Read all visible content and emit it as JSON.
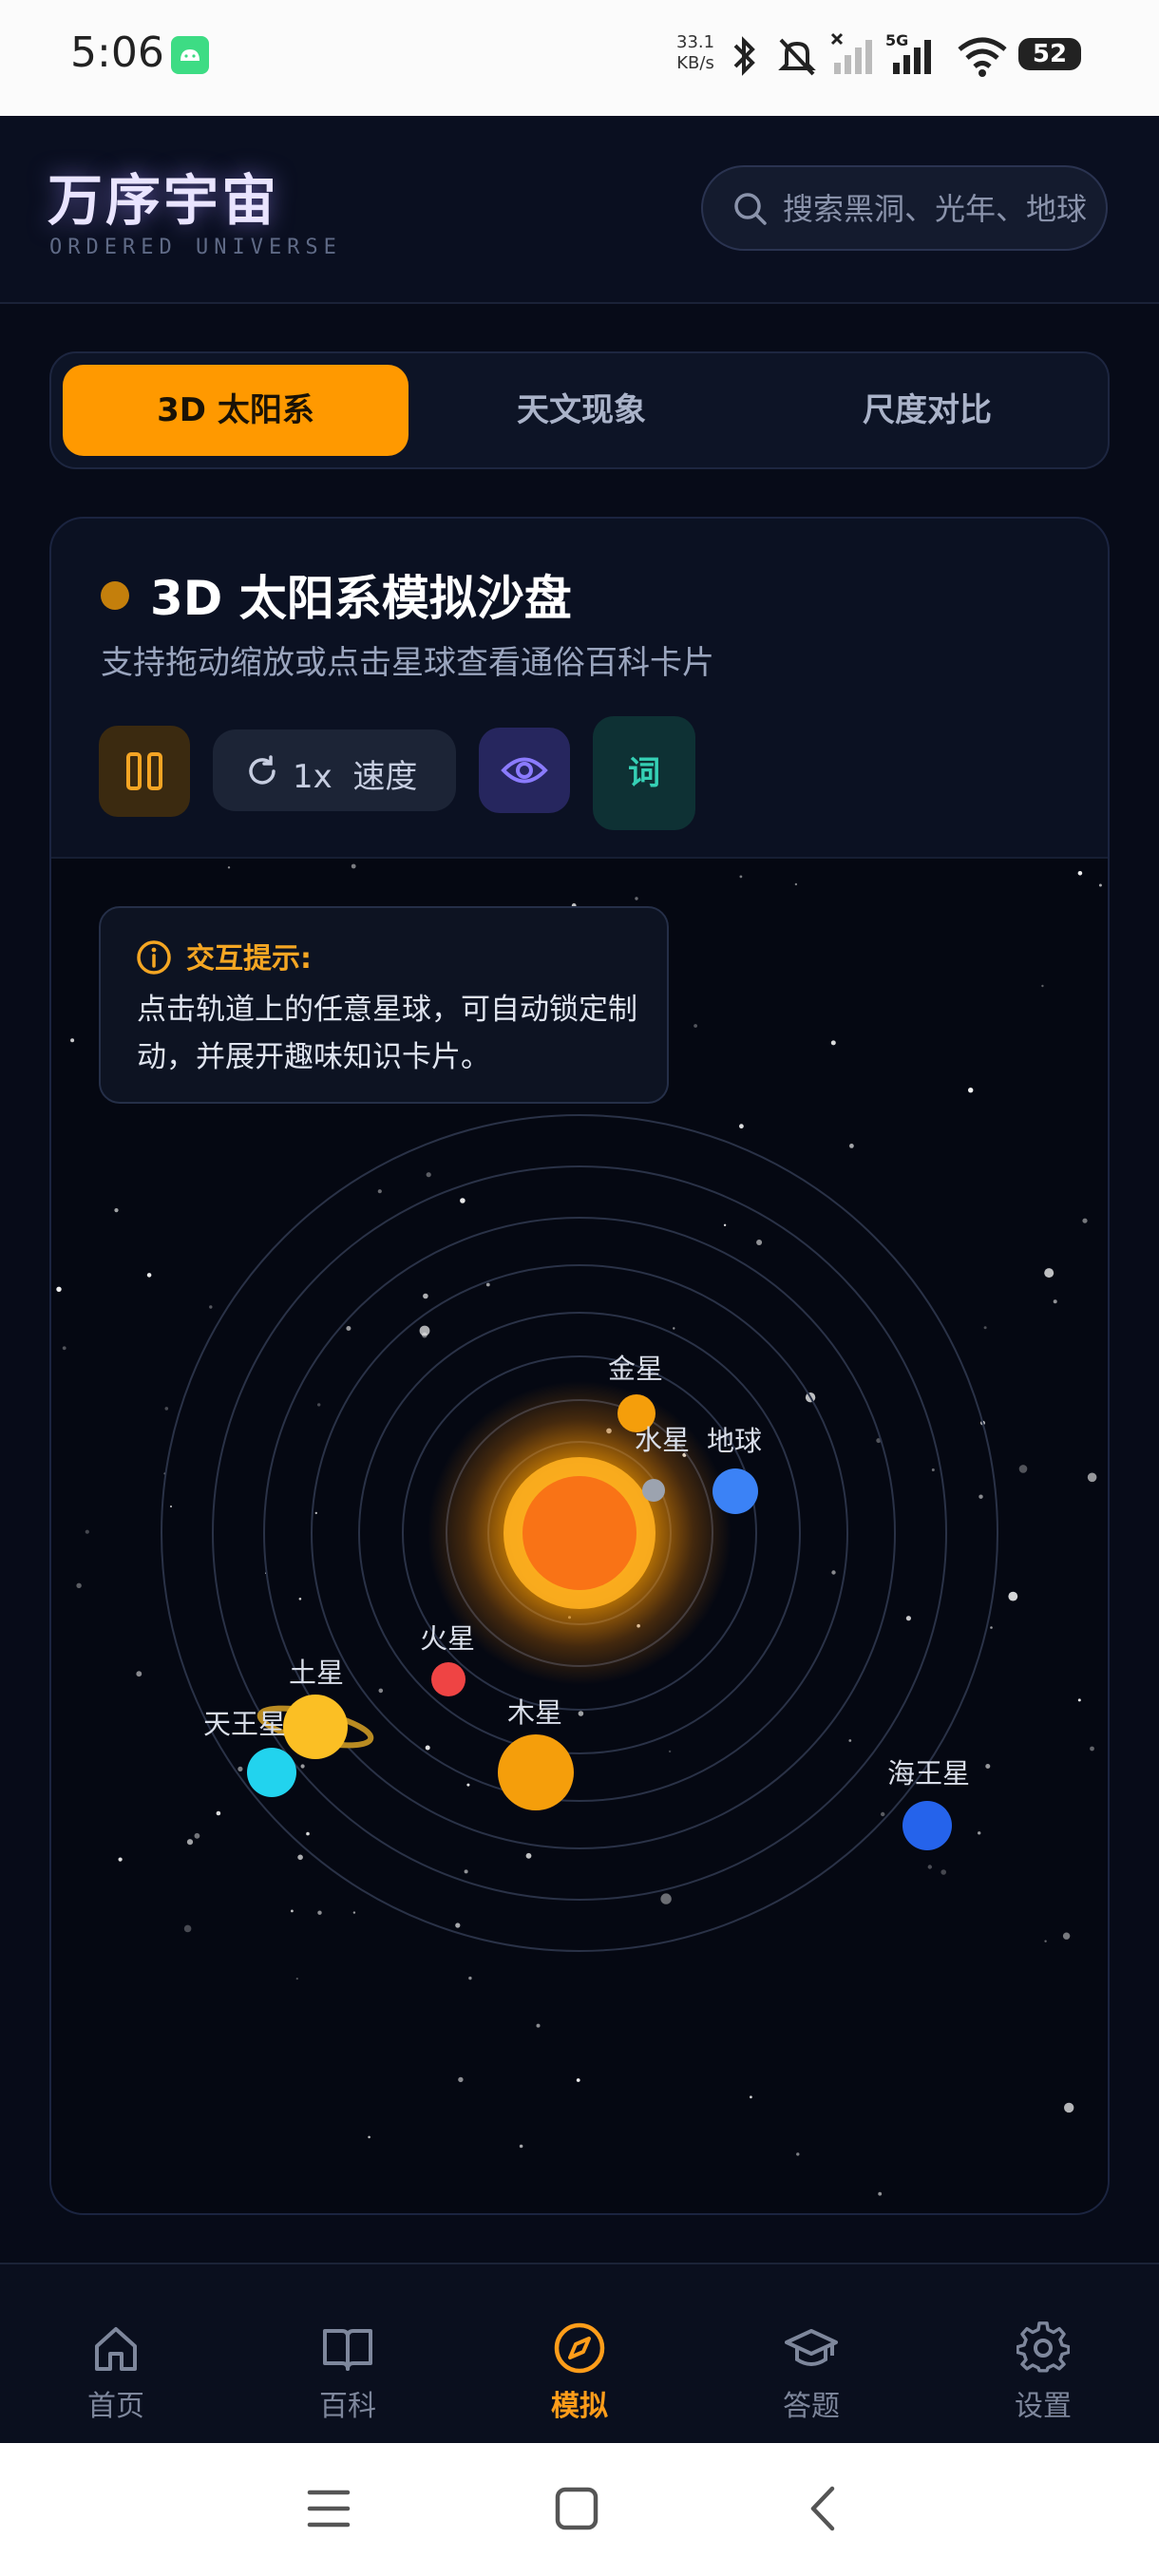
{
  "status_bar": {
    "time": "5:06",
    "net_speed_value": "33.1",
    "net_speed_unit": "KB/s",
    "network": "5G",
    "battery": "52",
    "icons": [
      "android-icon",
      "bluetooth-icon",
      "mute-icon",
      "no-signal-icon",
      "signal-icon",
      "wifi-icon",
      "battery-icon"
    ]
  },
  "header": {
    "title": "万序宇宙",
    "subtitle": "ORDERED UNIVERSE",
    "search_placeholder": "搜索黑洞、光年、地球"
  },
  "tabs": [
    {
      "label": "3D 太阳系",
      "active": true
    },
    {
      "label": "天文现象",
      "active": false
    },
    {
      "label": "尺度对比",
      "active": false
    }
  ],
  "card": {
    "title": "3D 太阳系模拟沙盘",
    "description": "支持拖动缩放或点击星球查看通俗百科卡片",
    "controls": {
      "speed_value": "1x",
      "speed_label": "速度",
      "glossary_label": "词"
    },
    "tip": {
      "title": "交互提示:",
      "body": "点击轨道上的任意星球，可自动锁定制动，并展开趣味知识卡片。"
    }
  },
  "planets": [
    {
      "name": "水星",
      "color": "#9ca3af"
    },
    {
      "name": "金星",
      "color": "#f59e0b"
    },
    {
      "name": "地球",
      "color": "#3b82f6"
    },
    {
      "name": "火星",
      "color": "#ef4444"
    },
    {
      "name": "木星",
      "color": "#f59e0b"
    },
    {
      "name": "土星",
      "color": "#fbbf24"
    },
    {
      "name": "天王星",
      "color": "#22d3ee"
    },
    {
      "name": "海王星",
      "color": "#2563eb"
    }
  ],
  "colors": {
    "accent": "#ff9900",
    "background": "#070b18",
    "sun": "#f97316"
  },
  "bottom_nav": [
    {
      "label": "首页",
      "icon": "home-icon",
      "active": false
    },
    {
      "label": "百科",
      "icon": "book-icon",
      "active": false
    },
    {
      "label": "模拟",
      "icon": "compass-icon",
      "active": true
    },
    {
      "label": "答题",
      "icon": "graduation-cap-icon",
      "active": false
    },
    {
      "label": "设置",
      "icon": "gear-icon",
      "active": false
    }
  ],
  "system_nav": [
    "menu-icon",
    "home-square-icon",
    "back-icon"
  ]
}
